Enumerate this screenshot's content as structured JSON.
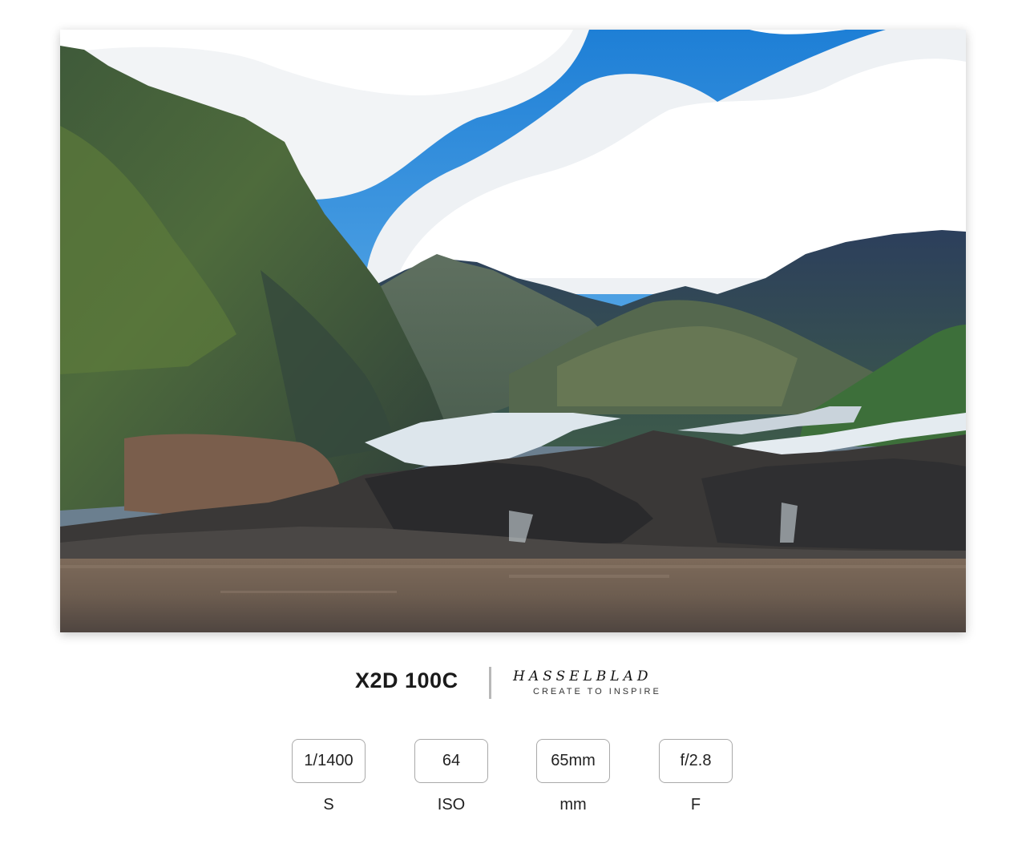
{
  "camera": {
    "model": "X2D 100C",
    "brand_logo": "HASSELBLAD",
    "brand_tagline": "CREATE TO INSPIRE"
  },
  "photo": {
    "subject": "glacier-landscape-photo"
  },
  "exif": [
    {
      "value": "1/1400",
      "label": "S"
    },
    {
      "value": "64",
      "label": "ISO"
    },
    {
      "value": "65mm",
      "label": "mm"
    },
    {
      "value": "f/2.8",
      "label": "F"
    }
  ],
  "colors": {
    "text": "#222222",
    "border": "#a9a9a9",
    "divider": "#b8b8b8"
  }
}
